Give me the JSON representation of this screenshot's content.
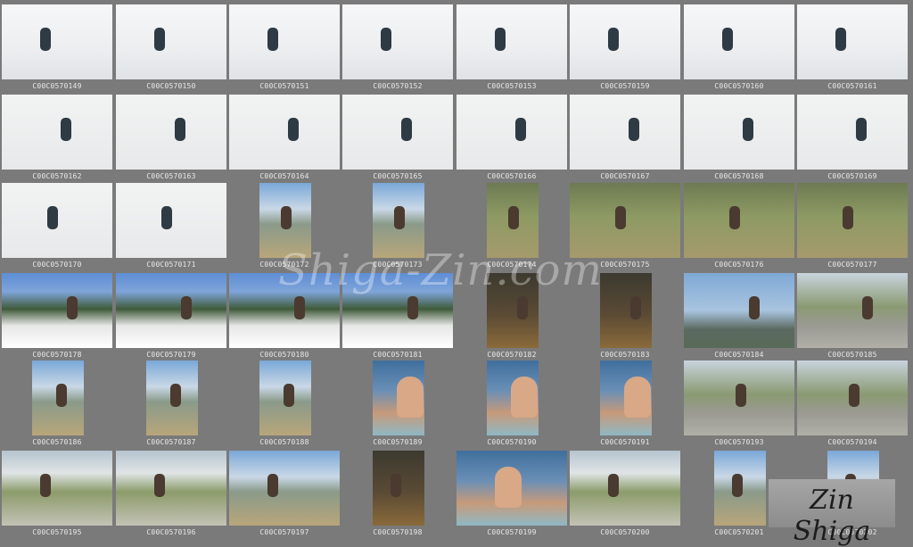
{
  "watermark": "Shiga-Zin.com",
  "signature": "Zin Shiga",
  "rows": [
    [
      {
        "code": "C00C0570149",
        "scene": "snow",
        "orient": "land"
      },
      {
        "code": "C00C0570150",
        "scene": "snow",
        "orient": "land"
      },
      {
        "code": "C00C0570151",
        "scene": "snow",
        "orient": "land"
      },
      {
        "code": "C00C0570152",
        "scene": "snow",
        "orient": "land"
      },
      {
        "code": "C00C0570153",
        "scene": "snow",
        "orient": "land"
      },
      {
        "code": "C00C0570159",
        "scene": "snow",
        "orient": "land"
      },
      {
        "code": "C00C0570160",
        "scene": "snow",
        "orient": "land"
      },
      {
        "code": "C00C0570161",
        "scene": "snow",
        "orient": "land"
      }
    ],
    [
      {
        "code": "C00C0570162",
        "scene": "snowg",
        "orient": "land"
      },
      {
        "code": "C00C0570163",
        "scene": "snowg",
        "orient": "land"
      },
      {
        "code": "C00C0570164",
        "scene": "snowg",
        "orient": "land"
      },
      {
        "code": "C00C0570165",
        "scene": "snowg",
        "orient": "land"
      },
      {
        "code": "C00C0570166",
        "scene": "snowg",
        "orient": "land"
      },
      {
        "code": "C00C0570167",
        "scene": "snowg",
        "orient": "land"
      },
      {
        "code": "C00C0570168",
        "scene": "snowg",
        "orient": "land"
      },
      {
        "code": "C00C0570169",
        "scene": "snowg",
        "orient": "land"
      }
    ],
    [
      {
        "code": "C00C0570170",
        "scene": "snowg",
        "orient": "land"
      },
      {
        "code": "C00C0570171",
        "scene": "snowg",
        "orient": "land"
      },
      {
        "code": "C00C0570172",
        "scene": "mtn",
        "orient": "port"
      },
      {
        "code": "C00C0570173",
        "scene": "mtn",
        "orient": "port"
      },
      {
        "code": "C00C0570174",
        "scene": "grass",
        "orient": "port"
      },
      {
        "code": "C00C0570175",
        "scene": "grass",
        "orient": "land"
      },
      {
        "code": "C00C0570176",
        "scene": "grass",
        "orient": "land"
      },
      {
        "code": "C00C0570177",
        "scene": "grass",
        "orient": "land"
      }
    ],
    [
      {
        "code": "C00C0570178",
        "scene": "town",
        "orient": "land"
      },
      {
        "code": "C00C0570179",
        "scene": "town",
        "orient": "land"
      },
      {
        "code": "C00C0570180",
        "scene": "town",
        "orient": "land"
      },
      {
        "code": "C00C0570181",
        "scene": "town",
        "orient": "land"
      },
      {
        "code": "C00C0570182",
        "scene": "dark",
        "orient": "port"
      },
      {
        "code": "C00C0570183",
        "scene": "dark",
        "orient": "port"
      },
      {
        "code": "C00C0570184",
        "scene": "sky",
        "orient": "land"
      },
      {
        "code": "C00C0570185",
        "scene": "road",
        "orient": "land"
      }
    ],
    [
      {
        "code": "C00C0570186",
        "scene": "mtn",
        "orient": "port"
      },
      {
        "code": "C00C0570187",
        "scene": "mtn",
        "orient": "port"
      },
      {
        "code": "C00C0570188",
        "scene": "mtn",
        "orient": "port"
      },
      {
        "code": "C00C0570189",
        "scene": "face",
        "orient": "port"
      },
      {
        "code": "C00C0570190",
        "scene": "face",
        "orient": "port"
      },
      {
        "code": "C00C0570191",
        "scene": "face",
        "orient": "port"
      },
      {
        "code": "C00C0570193",
        "scene": "road",
        "orient": "land"
      },
      {
        "code": "C00C0570194",
        "scene": "road",
        "orient": "land"
      }
    ],
    [
      {
        "code": "C00C0570195",
        "scene": "field",
        "orient": "land"
      },
      {
        "code": "C00C0570196",
        "scene": "field",
        "orient": "land"
      },
      {
        "code": "C00C0570197",
        "scene": "mtn",
        "orient": "land"
      },
      {
        "code": "C00C0570198",
        "scene": "dark",
        "orient": "port"
      },
      {
        "code": "C00C0570199",
        "scene": "face",
        "orient": "land"
      },
      {
        "code": "C00C0570200",
        "scene": "field",
        "orient": "land"
      },
      {
        "code": "C00C0570201",
        "scene": "mtn",
        "orient": "port"
      },
      {
        "code": "C00C0570202",
        "scene": "mtn",
        "orient": "port"
      }
    ]
  ]
}
